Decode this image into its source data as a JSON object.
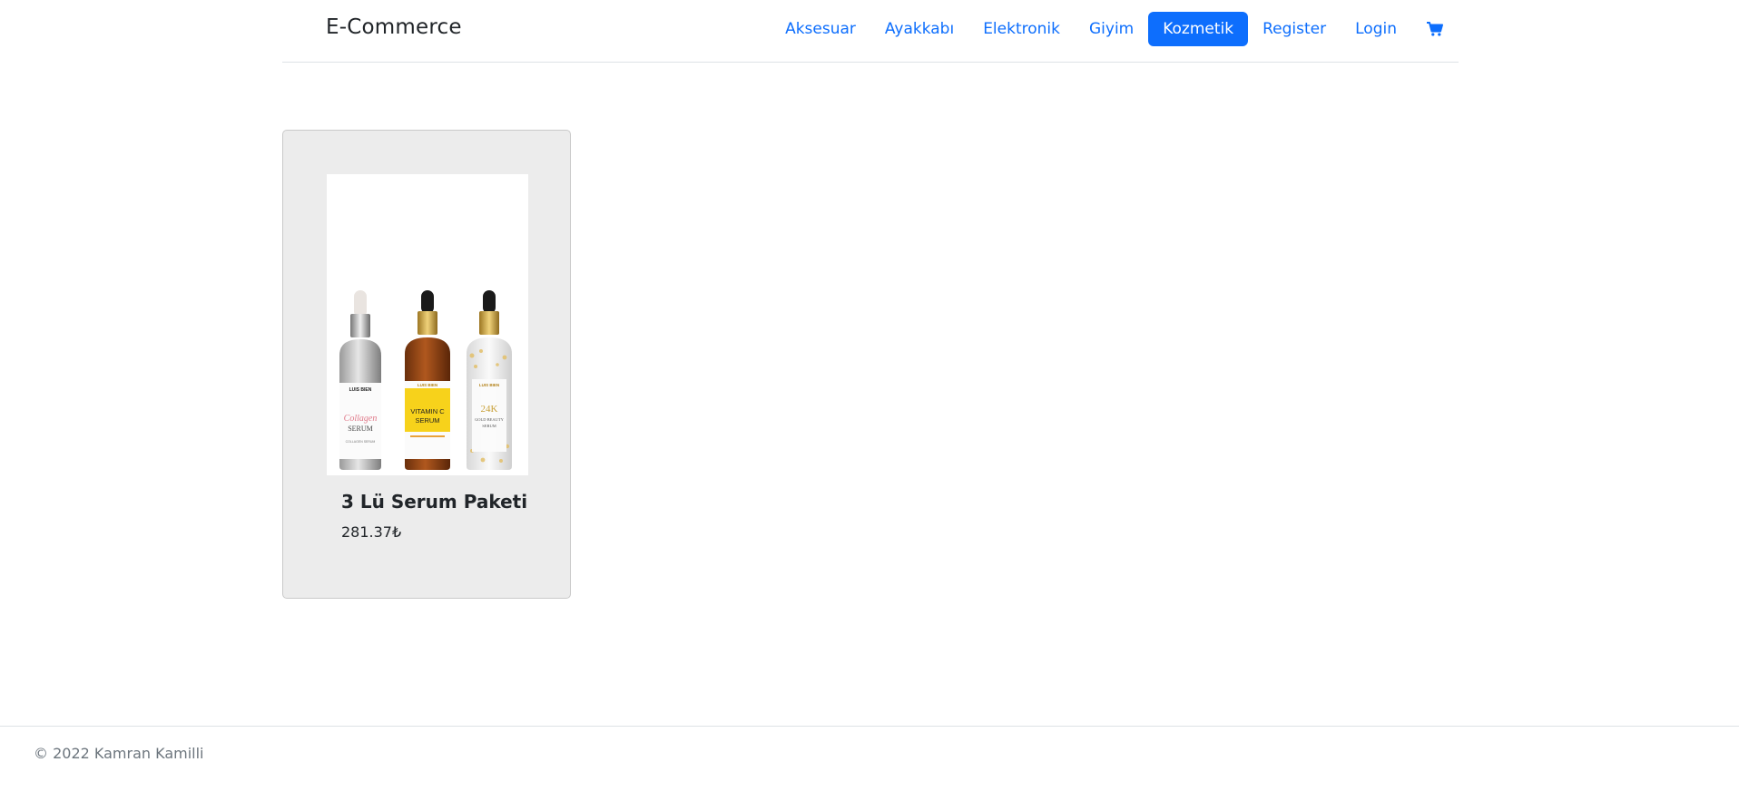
{
  "navbar": {
    "brand": "E-Commerce",
    "links": [
      {
        "label": "Aksesuar",
        "active": false
      },
      {
        "label": "Ayakkabı",
        "active": false
      },
      {
        "label": "Elektronik",
        "active": false
      },
      {
        "label": "Giyim",
        "active": false
      },
      {
        "label": "Kozmetik",
        "active": true
      },
      {
        "label": "Register",
        "active": false
      },
      {
        "label": "Login",
        "active": false
      }
    ],
    "cart_icon": "shopping-cart-icon"
  },
  "products": [
    {
      "title": "3 Lü Serum Paketi",
      "price": "281.37₺",
      "image": {
        "bottles": [
          {
            "brand": "LUIS BIEN",
            "name_line1": "Collagen",
            "name_line2": "SERUM",
            "sub": "COLLAGEN SERUM"
          },
          {
            "brand": "LUIS BIEN",
            "name_line1": "VITAMIN C",
            "name_line2": "SERUM",
            "sub": ""
          },
          {
            "brand": "LUIS BIEN",
            "name_line1": "24K",
            "name_line2": "GOLD BEAUTY",
            "sub": "SERUM"
          }
        ]
      }
    }
  ],
  "footer": {
    "text": "© 2022 Kamran Kamilli"
  },
  "colors": {
    "primary": "#0d6efd",
    "card_bg": "#ececec",
    "footer_text": "#6c757d"
  }
}
